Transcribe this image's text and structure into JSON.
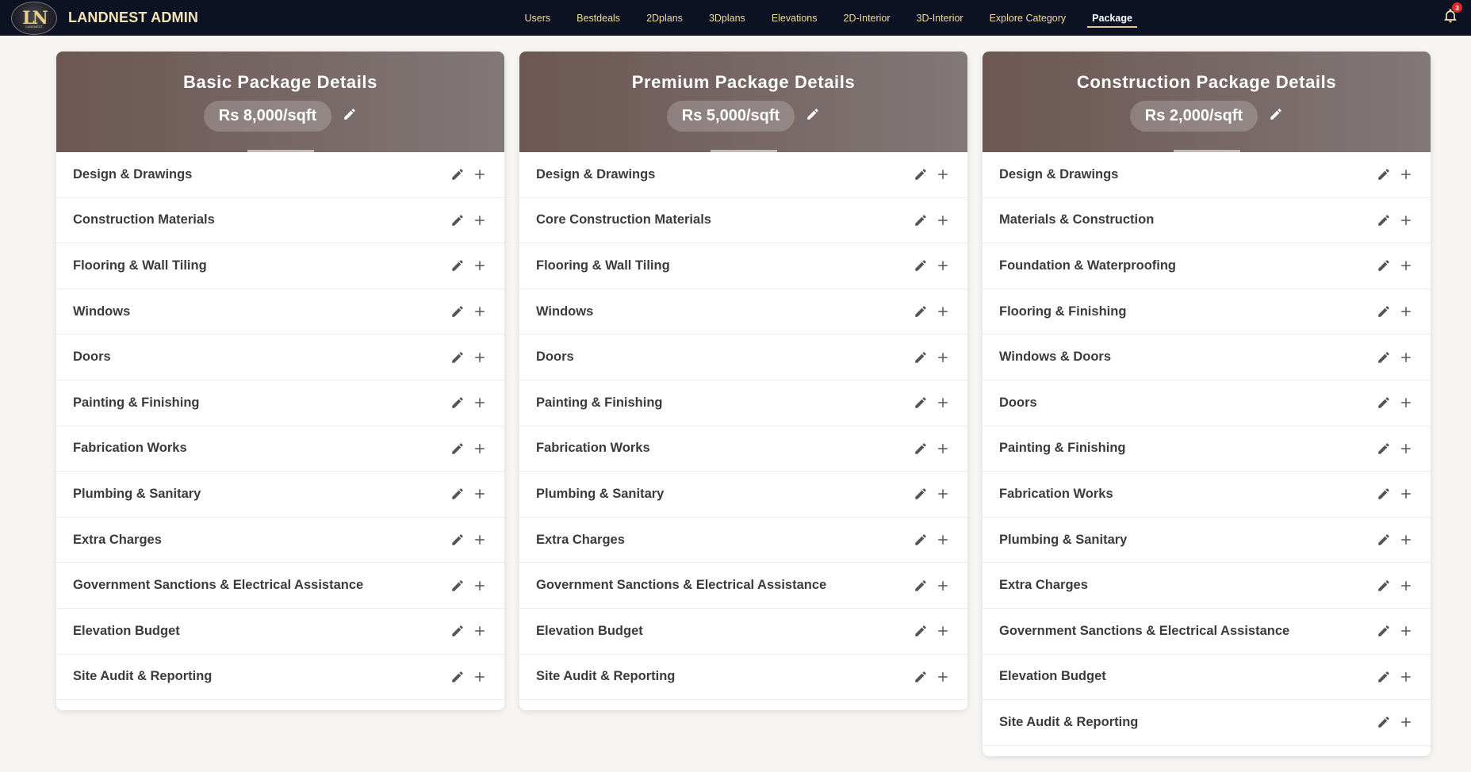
{
  "brand": {
    "name": "LANDNEST ADMIN",
    "logo_text": "LN",
    "logo_subtext": "LANDNEST"
  },
  "nav": {
    "links": [
      "Users",
      "Bestdeals",
      "2Dplans",
      "3Dplans",
      "Elevations",
      "2D-Interior",
      "3D-Interior",
      "Explore Category",
      "Package"
    ],
    "active": "Package"
  },
  "notifications": {
    "count": "3"
  },
  "colors": {
    "navbar_bg": "#0c1223",
    "nav_text": "#f1dc9c",
    "header_bg": "#776866",
    "accent": "#e9c979",
    "badge": "#e0252b"
  },
  "packages": [
    {
      "title": "Basic Package Details",
      "price": "Rs 8,000/sqft",
      "items": [
        "Design & Drawings",
        "Construction Materials",
        "Flooring & Wall Tiling",
        "Windows",
        "Doors",
        "Painting & Finishing",
        "Fabrication Works",
        "Plumbing & Sanitary",
        "Extra Charges",
        "Government Sanctions & Electrical Assistance",
        "Elevation Budget",
        "Site Audit & Reporting"
      ]
    },
    {
      "title": "Premium Package Details",
      "price": "Rs 5,000/sqft",
      "items": [
        "Design & Drawings",
        "Core Construction Materials",
        "Flooring & Wall Tiling",
        "Windows",
        "Doors",
        "Painting & Finishing",
        "Fabrication Works",
        "Plumbing & Sanitary",
        "Extra Charges",
        "Government Sanctions & Electrical Assistance",
        "Elevation Budget",
        "Site Audit & Reporting"
      ]
    },
    {
      "title": "Construction Package Details",
      "price": "Rs 2,000/sqft",
      "items": [
        "Design & Drawings",
        "Materials & Construction",
        "Foundation & Waterproofing",
        "Flooring & Finishing",
        "Windows & Doors",
        "Doors",
        "Painting & Finishing",
        "Fabrication Works",
        "Plumbing & Sanitary",
        "Extra Charges",
        "Government Sanctions & Electrical Assistance",
        "Elevation Budget",
        "Site Audit & Reporting"
      ]
    }
  ],
  "icons": {
    "edit": "pencil-icon",
    "add": "plus-icon",
    "notifications": "bell-icon"
  }
}
